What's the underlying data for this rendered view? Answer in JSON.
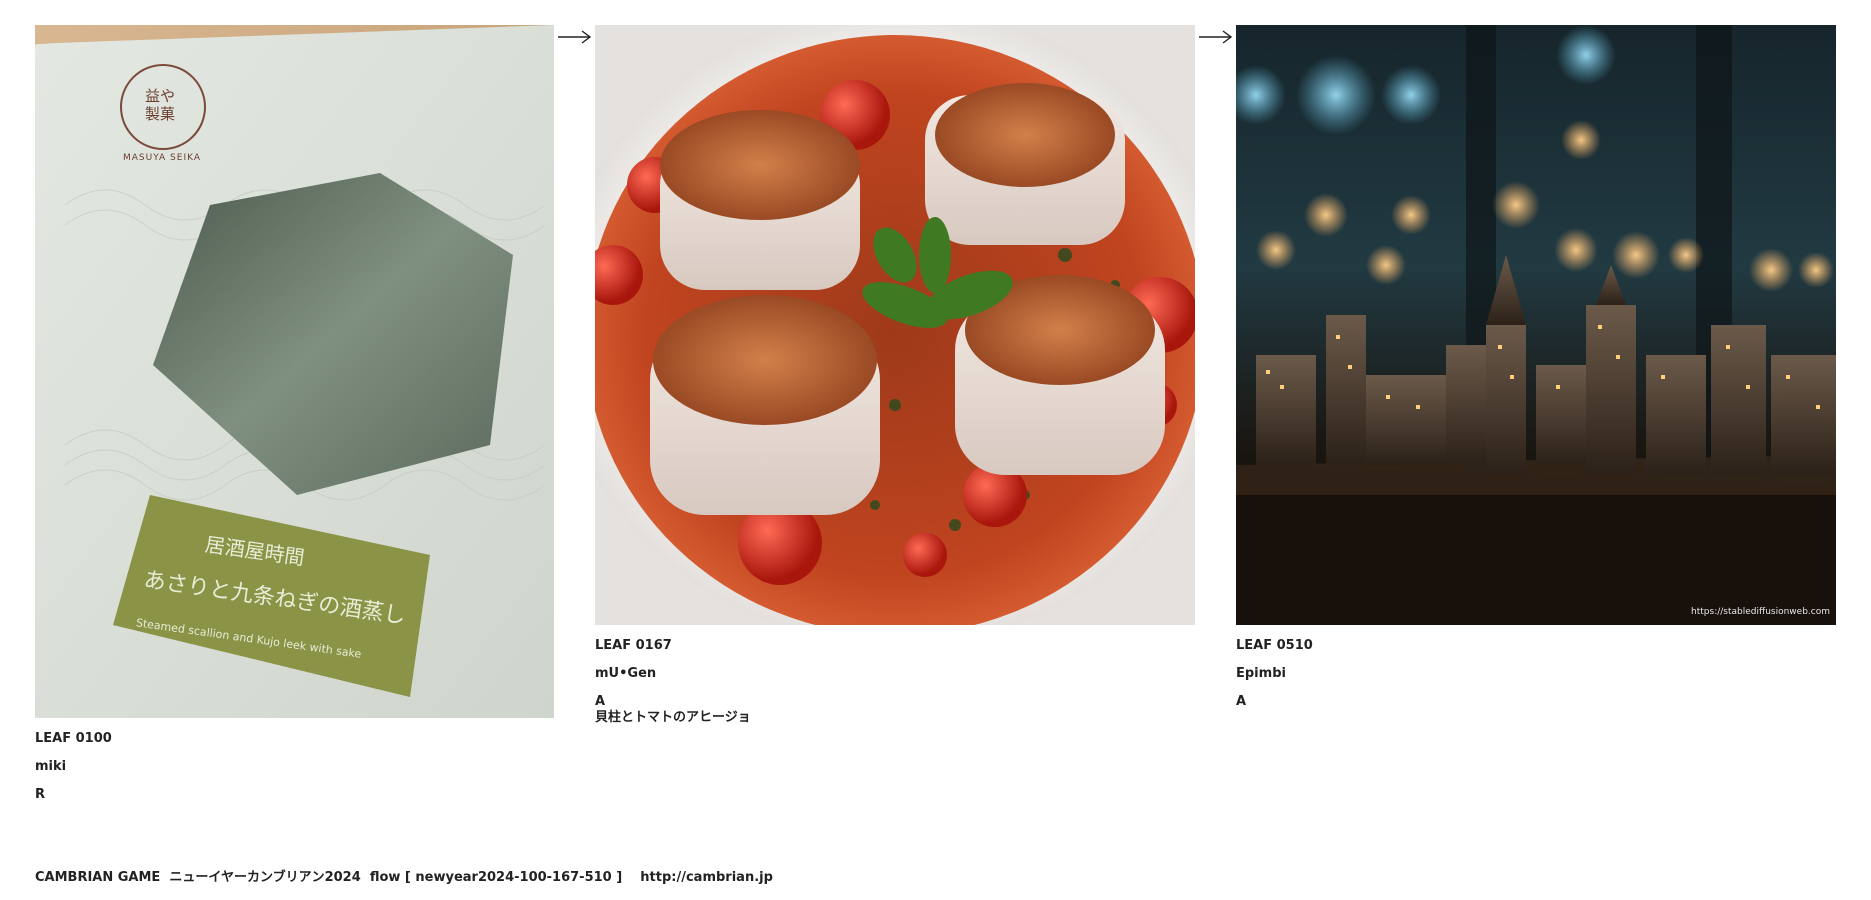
{
  "cards": [
    {
      "leaf": "LEAF 0100",
      "author": "miki",
      "grade": "R",
      "dish": "",
      "package": {
        "brand_jp": "益や製菓",
        "brand_en": "MASUYA SEIKA",
        "label_top": "居酒屋時間",
        "label_main": "あさりと九条ねぎの酒蒸し",
        "label_en": "Steamed scallion and Kujo leek with sake"
      }
    },
    {
      "leaf": "LEAF 0167",
      "author": "mU•Gen",
      "grade": "A",
      "dish": "貝柱とトマトのアヒージョ"
    },
    {
      "leaf": "LEAF 0510",
      "author": "Epimbi",
      "grade": "A",
      "dish": "",
      "watermark": "https://stablediffusionweb.com"
    }
  ],
  "footer": "CAMBRIAN GAME  ニューイヤーカンブリアン2024  flow [ newyear2024-100-167-510 ]    http://cambrian.jp",
  "colors": {
    "wood": "#c9a57c",
    "package": "#d7dcd4",
    "label_green": "#8a9346",
    "sauce": "#b8351e",
    "night": "#0d1418"
  }
}
